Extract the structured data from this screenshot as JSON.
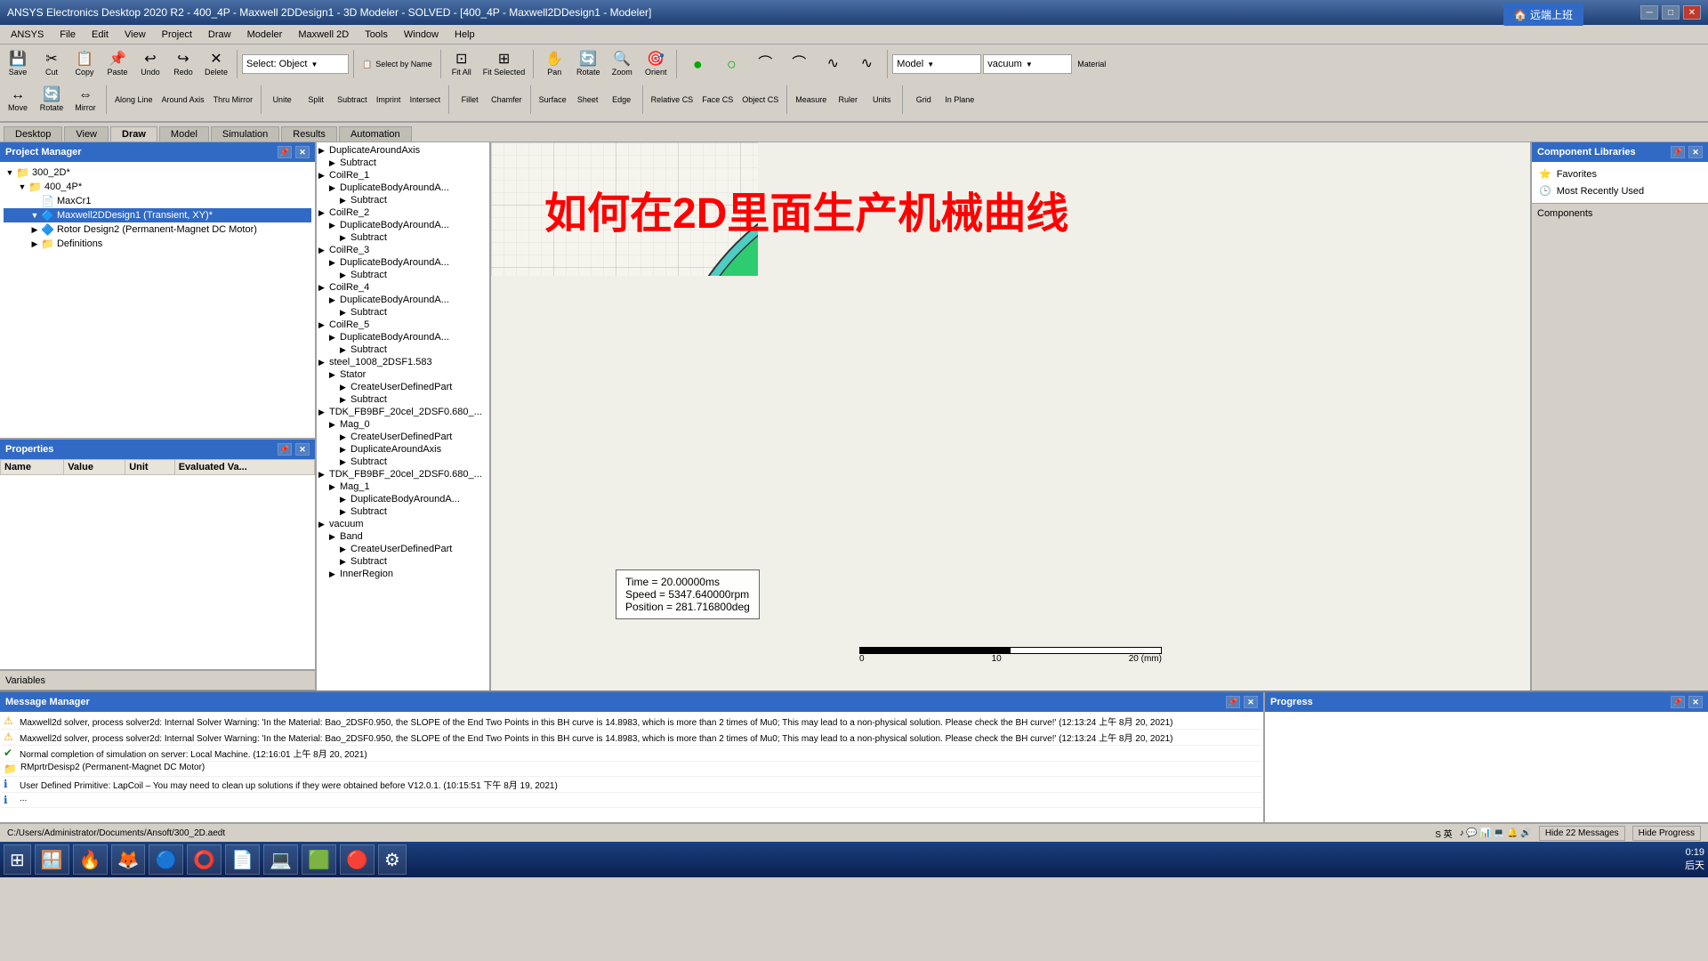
{
  "titlebar": {
    "title": "ANSYS Electronics Desktop 2020 R2 - 400_4P - Maxwell 2DDesign1 - 3D Modeler - SOLVED - [400_4P - Maxwell2DDesign1 - Modeler]",
    "minimize": "─",
    "maximize": "□",
    "close": "✕"
  },
  "menubar": {
    "items": [
      "ANSYS",
      "File",
      "Edit",
      "View",
      "Project",
      "Draw",
      "Modeler",
      "Maxwell 2D",
      "Tools",
      "Window",
      "Help"
    ]
  },
  "toolbar": {
    "row1": {
      "save_label": "Save",
      "cut_label": "Cut",
      "copy_label": "Copy",
      "paste_label": "Paste",
      "undo_label": "Undo",
      "redo_label": "Redo",
      "delete_label": "Delete",
      "select_object": "Select: Object",
      "select_by_name": "Select by Name",
      "fit_all": "Fit All",
      "fit_selected": "Fit Selected",
      "pan": "Pan",
      "rotate": "Rotate",
      "zoom": "Zoom",
      "orient": "Orient"
    },
    "row2": {
      "move_label": "Move",
      "rotate_label": "Rotate",
      "mirror_label": "Mirror",
      "along_line": "Along Line",
      "around_axis": "Around Axis",
      "thru_mirror": "Thru Mirror",
      "unite_label": "Unite",
      "split_label": "Split",
      "subtract_label": "Subtract",
      "imprint_label": "Imprint",
      "intersect_label": "Intersect",
      "fillet_label": "Fillet",
      "chamfer_label": "Chamfer",
      "surface_label": "Surface",
      "sheet_label": "Sheet",
      "edge_label": "Edge",
      "relative_cs": "Relative CS",
      "face_cs": "Face CS",
      "object_cs": "Object CS",
      "measure": "Measure",
      "ruler": "Ruler",
      "units": "Units",
      "grid": "Grid",
      "in_plane": "In Plane",
      "model_label": "Model",
      "model_val": "vacuum",
      "material": "Material"
    }
  },
  "tabbar": {
    "tabs": [
      "Desktop",
      "View",
      "Draw",
      "Model",
      "Simulation",
      "Results",
      "Automation"
    ]
  },
  "project_manager": {
    "title": "Project Manager",
    "items": [
      {
        "id": "300_2D",
        "label": "300_2D*",
        "depth": 0,
        "type": "folder"
      },
      {
        "id": "400_4P",
        "label": "400_4P*",
        "depth": 1,
        "type": "folder"
      },
      {
        "id": "MaxCr1",
        "label": "MaxCr1",
        "depth": 2,
        "type": "file"
      },
      {
        "id": "Maxwell2DDesign1",
        "label": "Maxwell2DDesign1 (Transient, XY)*",
        "depth": 2,
        "type": "design",
        "selected": true
      },
      {
        "id": "RotorDesign2",
        "label": "Rotor Design2 (Permanent-Magnet DC Motor)",
        "depth": 2,
        "type": "design"
      },
      {
        "id": "Definitions",
        "label": "Definitions",
        "depth": 2,
        "type": "folder"
      }
    ]
  },
  "properties": {
    "title": "Properties",
    "columns": [
      "Name",
      "Value",
      "Unit",
      "Evaluated Va..."
    ],
    "rows": []
  },
  "variables_bar": {
    "label": "Variables"
  },
  "center_tree": {
    "items": [
      {
        "label": "DuplicateAroundAxis",
        "depth": 0
      },
      {
        "label": "Subtract",
        "depth": 1
      },
      {
        "label": "CoilRe_1",
        "depth": 0
      },
      {
        "label": "DuplicateBodyAroundA...",
        "depth": 1
      },
      {
        "label": "Subtract",
        "depth": 2
      },
      {
        "label": "CoilRe_2",
        "depth": 0
      },
      {
        "label": "DuplicateBodyAroundA...",
        "depth": 1
      },
      {
        "label": "Subtract",
        "depth": 2
      },
      {
        "label": "CoilRe_3",
        "depth": 0
      },
      {
        "label": "DuplicateBodyAroundA...",
        "depth": 1
      },
      {
        "label": "Subtract",
        "depth": 2
      },
      {
        "label": "CoilRe_4",
        "depth": 0
      },
      {
        "label": "DuplicateBodyAroundA...",
        "depth": 1
      },
      {
        "label": "Subtract",
        "depth": 2
      },
      {
        "label": "CoilRe_5",
        "depth": 0
      },
      {
        "label": "DuplicateBodyAroundA...",
        "depth": 1
      },
      {
        "label": "Subtract",
        "depth": 2
      },
      {
        "label": "steel_1008_2DSF1.583",
        "depth": 0
      },
      {
        "label": "Stator",
        "depth": 1
      },
      {
        "label": "CreateUserDefinedPart",
        "depth": 2
      },
      {
        "label": "Subtract",
        "depth": 2
      },
      {
        "label": "TDK_FB9BF_20cel_2DSF0.680_...",
        "depth": 0
      },
      {
        "label": "Mag_0",
        "depth": 1
      },
      {
        "label": "CreateUserDefinedPart",
        "depth": 2
      },
      {
        "label": "DuplicateAroundAxis",
        "depth": 2
      },
      {
        "label": "Subtract",
        "depth": 2
      },
      {
        "label": "TDK_FB9BF_20cel_2DSF0.680_...",
        "depth": 0
      },
      {
        "label": "Mag_1",
        "depth": 1
      },
      {
        "label": "DuplicateBodyAroundA...",
        "depth": 2
      },
      {
        "label": "Subtract",
        "depth": 2
      },
      {
        "label": "vacuum",
        "depth": 0
      },
      {
        "label": "Band",
        "depth": 1
      },
      {
        "label": "CreateUserDefinedPart",
        "depth": 2
      },
      {
        "label": "Subtract",
        "depth": 2
      },
      {
        "label": "InnerRegion",
        "depth": 1
      }
    ]
  },
  "viewport": {
    "chinese_text": "如何在2D里面生产机械曲线",
    "status_overlay": {
      "time": "Time    =  20.00000ms",
      "speed": "Speed  =  5347.640000rpm",
      "position": "Position = 281.716800deg"
    },
    "scale": {
      "label_left": "0",
      "label_mid": "10",
      "label_right": "20 (mm)"
    }
  },
  "component_libraries": {
    "title": "Component Libraries",
    "items": [
      {
        "label": "Favorites"
      },
      {
        "label": "Most Recently Used"
      }
    ],
    "footer": "Components"
  },
  "message_manager": {
    "title": "Message Manager",
    "messages": [
      {
        "type": "warning",
        "text": "Maxwell2d solver, process solver2d: Internal Solver Warning: 'In the Material: Bao_2DSF0.950, the SLOPE of the End Two Points in this BH curve is 14.8983, which is more than 2 times of MuO; This may lead to a non-physical solution. Please check the BH curve!' (12:13:24 上午 8月 20, 2021)"
      },
      {
        "type": "warning",
        "text": "Maxwell2d solver, process solver2d: Internal Solver Warning: 'In the Material: Bao_2DSF0.950, the SLOPE of the End Two Points in this BH curve is 14.8983, which is more than 2 times of MuO; This may lead to a non-physical solution. Please check the BH curve!' (12:13:24 上午 8月 20, 2021)"
      },
      {
        "type": "success",
        "text": "Normal completion of simulation on server: Local Machine. (12:16:01 上午 8月 20, 2021)"
      },
      {
        "type": "folder",
        "text": "RMprtrDesisp2 (Permanent-Magnet DC Motor)"
      },
      {
        "type": "info",
        "text": "User Defined Primitive: LapCoil - You may need to clean up solutions if they were obtained before V12.0.1. (10:15:51 下午 8月 19, 2021)"
      },
      {
        "type": "info",
        "text": "..."
      }
    ]
  },
  "progress": {
    "title": "Progress"
  },
  "statusbar": {
    "path": "C:/Users/Administrator/Documents/Ansoft/300_2D.aedt",
    "hide_messages": "Hide 22 Messages",
    "hide_progress": "Hide Progress",
    "time": "0:19 后天",
    "date": ""
  },
  "taskbar": {
    "start_icon": "⊞",
    "apps": [
      {
        "icon": "🪟",
        "label": ""
      },
      {
        "icon": "🦊",
        "label": ""
      },
      {
        "icon": "🔵",
        "label": ""
      },
      {
        "icon": "🔴",
        "label": ""
      },
      {
        "icon": "⭕",
        "label": ""
      },
      {
        "icon": "📄",
        "label": ""
      },
      {
        "icon": "💻",
        "label": ""
      },
      {
        "icon": "🟩",
        "label": ""
      }
    ],
    "time": "0:19",
    "date": "后天"
  },
  "announce_btn": "🏠 远端上班"
}
